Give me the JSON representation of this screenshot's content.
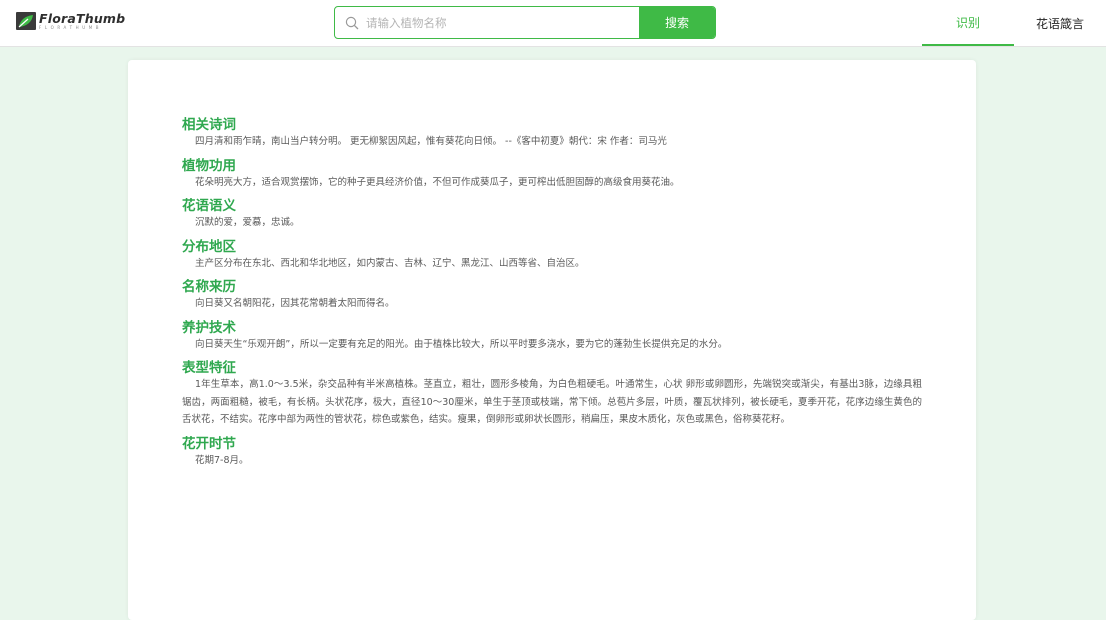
{
  "brand": {
    "name": "FloraThumb",
    "subtitle": "FLORATHUMB",
    "logo_icon": "leaf-logo-icon"
  },
  "search": {
    "placeholder": "请输入植物名称",
    "value": "",
    "button_label": "搜索",
    "icon": "search-icon"
  },
  "nav": {
    "tabs": [
      {
        "label": "识别",
        "active": true
      },
      {
        "label": "花语箴言",
        "active": false
      }
    ]
  },
  "colors": {
    "accent": "#3fba46",
    "title_green": "#2fa84f",
    "page_bg": "#e9f6ec"
  },
  "sections": [
    {
      "title": "相关诗词",
      "body": "四月清和雨乍晴，南山当户转分明。 更无柳絮因风起，惟有葵花向日倾。 --《客中初夏》朝代：宋 作者：司马光"
    },
    {
      "title": "植物功用",
      "body": "花朵明亮大方，适合观赏摆饰，它的种子更具经济价值，不但可作成葵瓜子，更可榨出低胆固醇的高级食用葵花油。"
    },
    {
      "title": "花语语义",
      "body": "沉默的爱，爱慕，忠诚。"
    },
    {
      "title": "分布地区",
      "body": "主产区分布在东北、西北和华北地区，如内蒙古、吉林、辽宁、黑龙江、山西等省、自治区。"
    },
    {
      "title": "名称来历",
      "body": "向日葵又名朝阳花，因其花常朝着太阳而得名。"
    },
    {
      "title": "养护技术",
      "body": "向日葵天生“乐观开朗”，所以一定要有充足的阳光。由于植株比较大，所以平时要多浇水，要为它的蓬勃生长提供充足的水分。"
    },
    {
      "title": "表型特征",
      "body": "1年生草本，高1.0～3.5米，杂交品种有半米高植株。茎直立，粗壮，圆形多棱角，为白色粗硬毛。叶通常生，心状 卵形或卵圆形，先端锐突或渐尖，有基出3脉，边缘具粗锯齿，两面粗糙，被毛，有长柄。头状花序，极大，直径10～30厘米，单生于茎顶或枝端，常下倾。总苞片多层，叶质，覆瓦状排列，被长硬毛，夏季开花，花序边缘生黄色的舌状花，不结实。花序中部为两性的管状花，棕色或紫色，结实。瘦果，倒卵形或卵状长圆形，稍扁压，果皮木质化，灰色或黑色，俗称葵花籽。"
    },
    {
      "title": "花开时节",
      "body": "花期7-8月。"
    }
  ]
}
